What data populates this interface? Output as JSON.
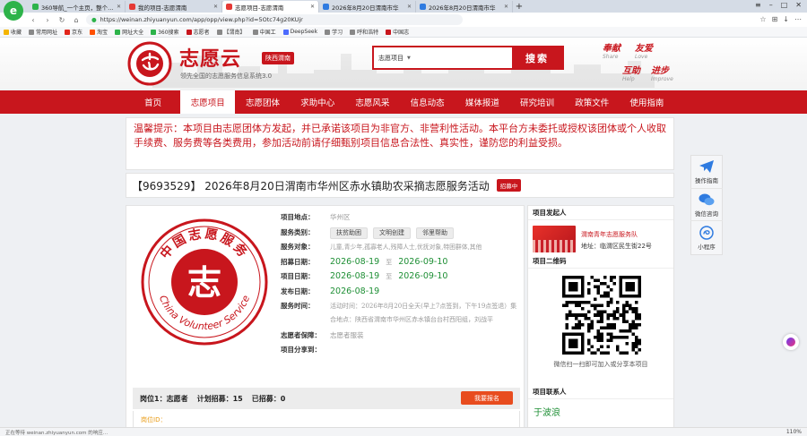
{
  "browser": {
    "tabs": [
      {
        "title": "360导航_一个主页，整个世界",
        "active": false
      },
      {
        "title": "我的项目-志愿渭南",
        "active": false
      },
      {
        "title": "志愿项目-志愿渭南",
        "active": true
      },
      {
        "title": "2026年8月20日渭南市华",
        "active": false
      },
      {
        "title": "2026年8月20日渭南市华",
        "active": false
      }
    ],
    "url": "https://weinan.zhiyuanyun.com/app/opp/view.php?id=5Otc74g20KUjr",
    "bookmarks": [
      "收藏",
      "常用网址",
      "京东",
      "淘宝",
      "网址大全",
      "360搜索",
      "志愿者",
      "【渭南】",
      "中国工",
      "DeepSeek",
      "学习",
      "呼和浩特",
      "中国志"
    ],
    "status_text": "正在等待 weinan.zhiyuanyun.com 的响应…",
    "zoom": "110%"
  },
  "header": {
    "brand_title": "志愿云",
    "region": "陕西渭南",
    "slogan": "领先全国的志愿服务信息系统3.0",
    "search_category": "志愿项目",
    "search_button": "搜索",
    "motto": [
      {
        "cn": "奉献",
        "en": "Share"
      },
      {
        "cn": "友爱",
        "en": "Love"
      },
      {
        "cn": "互助",
        "en": "Help"
      },
      {
        "cn": "进步",
        "en": "Improve"
      }
    ]
  },
  "nav": [
    {
      "label": "首页",
      "active": false
    },
    {
      "label": "志愿项目",
      "active": true
    },
    {
      "label": "志愿团体",
      "active": false
    },
    {
      "label": "求助中心",
      "active": false
    },
    {
      "label": "志愿风采",
      "active": false
    },
    {
      "label": "信息动态",
      "active": false
    },
    {
      "label": "媒体报道",
      "active": false
    },
    {
      "label": "研究培训",
      "active": false
    },
    {
      "label": "政策文件",
      "active": false
    },
    {
      "label": "使用指南",
      "active": false
    }
  ],
  "notice": "温馨提示：本项目由志愿团体方发起，并已承诺该项目为非官方、非营利性活动。本平台方未委托或授权该团体或个人收取手续费、服务费等各类费用，参加活动前请仔细甄别项目信息合法性、真实性，谨防您的利益受损。",
  "project": {
    "title": "【9693529】 2026年8月20日渭南市华州区赤水镇助农采摘志愿服务活动",
    "status": "招募中",
    "emblem_text": {
      "top": "中国志愿服务",
      "bottom": "China Volunteer Service",
      "center": "志"
    },
    "location_label": "项目地点：",
    "location": "华州区",
    "category_label": "服务类别：",
    "categories": [
      "扶贫助困",
      "文明创建",
      "邻里帮助"
    ],
    "target_label": "服务对象：",
    "target": "儿童,青少年,孤寡老人,残障人士,优抚对象,特困群体,其他",
    "recruit_label": "招募日期：",
    "recruit_start": "2026-08-19",
    "recruit_end": "2026-09-10",
    "project_date_label": "项目日期：",
    "project_start": "2026-08-19",
    "project_end": "2026-09-10",
    "publish_label": "发布日期：",
    "publish_date": "2026-08-19",
    "time_label": "服务时间：",
    "time": "活动时间：2026年8月20日全天(早上7点签到，下午19点签退）集合地点：陕西省渭南市华州区赤水镇台台村西阳组，刘战平",
    "range_sep": "至",
    "insurance_label": "志愿者保障：",
    "insurance": "志愿者服装",
    "share_label": "项目分享到：",
    "stats": {
      "position_label": "岗位1：",
      "position_name": "志愿者",
      "plan_label": "计划招募：",
      "plan": "15",
      "recruited_label": "已招募：",
      "recruited": "0"
    },
    "apply_button": "我要报名",
    "position_link": "岗位ID："
  },
  "sidebar": {
    "initiator_heading": "项目发起人",
    "org_name": "渭南青年志愿服务队",
    "org_address": "地址：临渭区民生街22号",
    "qr_heading": "项目二维码",
    "qr_caption": "微信扫一扫即可加入或分享本项目",
    "contact_heading": "项目联系人",
    "contact_name": "于波浪"
  },
  "float_bar": [
    {
      "label": "操作指南",
      "icon": "paper-plane-icon"
    },
    {
      "label": "微信咨询",
      "icon": "wechat-icon"
    },
    {
      "label": "小程序",
      "icon": "mini-program-icon"
    }
  ],
  "colors": {
    "brand_red": "#c8161d",
    "green": "#1e8f35",
    "orange": "#e84c1e"
  }
}
